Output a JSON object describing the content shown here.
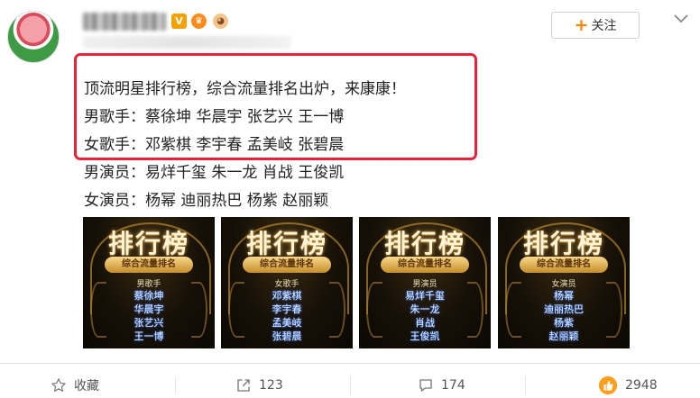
{
  "header": {
    "follow_label": "关注",
    "follow_plus": "+"
  },
  "badges": {
    "v": "V"
  },
  "post": {
    "lines": [
      "顶流明星排行榜，综合流量排名出炉，来康康！",
      "男歌手：蔡徐坤 华晨宇 张艺兴 王一博",
      "女歌手：邓紫棋 李宇春 孟美岐 张碧晨",
      "男演员：易烊千玺 朱一龙 肖战 王俊凯",
      "女演员：杨幂 迪丽热巴 杨紫 赵丽颖"
    ]
  },
  "thumbnails": [
    {
      "title": "排行榜",
      "banner": "综合流量排名",
      "category": "男歌手",
      "names": [
        "蔡徐坤",
        "华晨宇",
        "张艺兴",
        "王一博"
      ]
    },
    {
      "title": "排行榜",
      "banner": "综合流量排名",
      "category": "女歌手",
      "names": [
        "邓紫棋",
        "李宇春",
        "孟美岐",
        "张碧晨"
      ]
    },
    {
      "title": "排行榜",
      "banner": "综合流量排名",
      "category": "男演员",
      "names": [
        "易烊千玺",
        "朱一龙",
        "肖战",
        "王俊凯"
      ]
    },
    {
      "title": "排行榜",
      "banner": "综合流量排名",
      "category": "女演员",
      "names": [
        "杨幂",
        "迪丽热巴",
        "杨紫",
        "赵丽颖"
      ]
    }
  ],
  "actions": {
    "favorite_label": "收藏",
    "share_count": "123",
    "comment_count": "174",
    "like_count": "2948"
  },
  "colors": {
    "accent_orange": "#ff8200",
    "highlight_red": "#e8223a"
  },
  "icons": {
    "favorite": "star-icon",
    "share": "share-icon",
    "comment": "comment-icon",
    "like": "thumbs-up-icon",
    "menu": "chevron-down-icon"
  }
}
